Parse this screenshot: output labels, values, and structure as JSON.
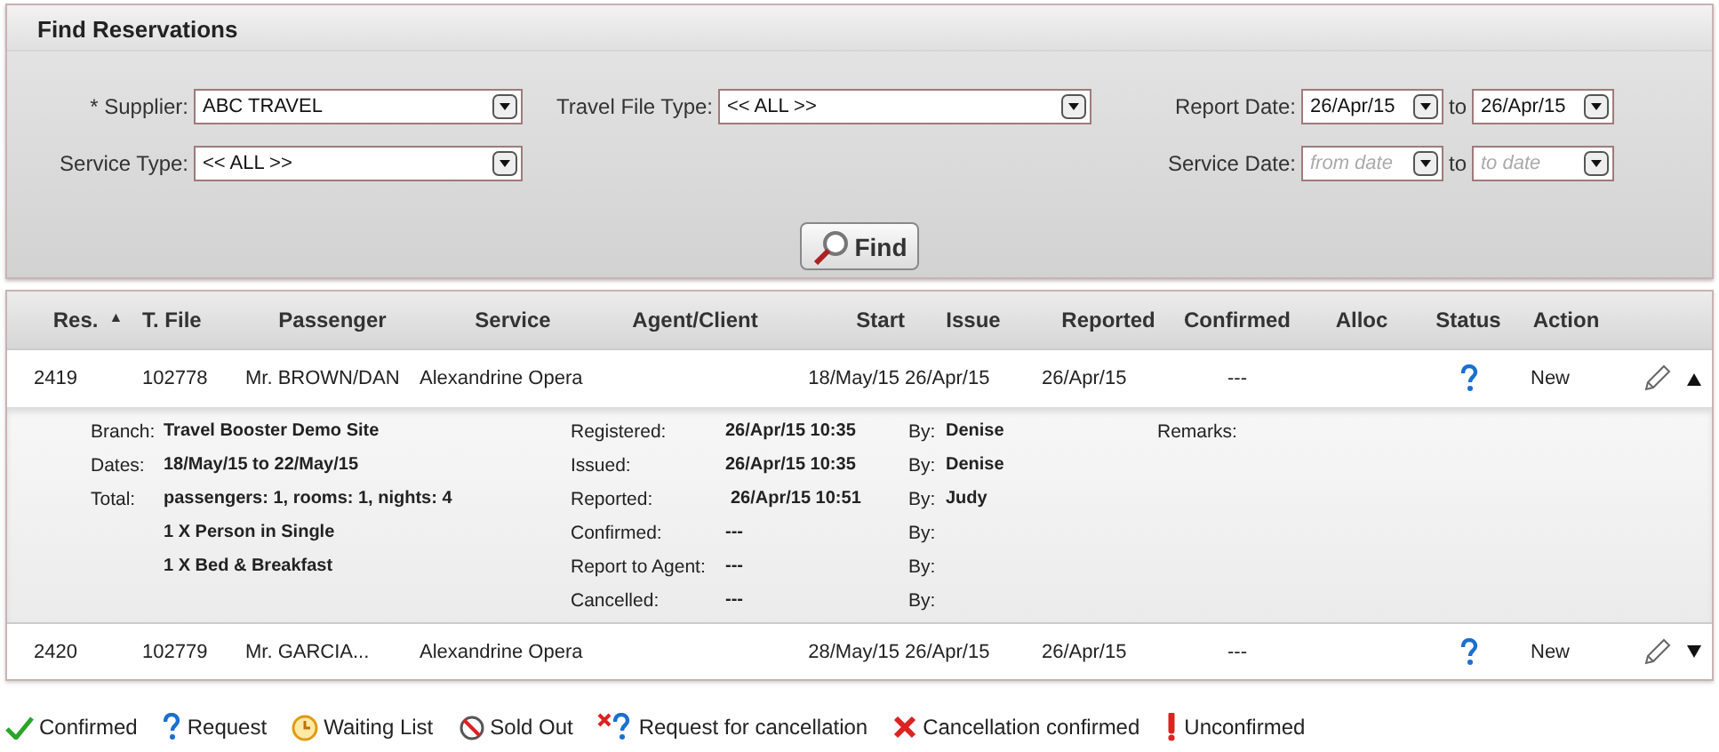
{
  "search_panel": {
    "title": "Find Reservations",
    "field_columns": [
      [
        {
          "kind": "select",
          "label": "* Supplier:",
          "value": "ABC TRAVEL"
        },
        {
          "kind": "select",
          "label": "Service Type:",
          "value": "<< ALL >>"
        }
      ],
      [
        {
          "kind": "select",
          "label": "Travel File Type:",
          "value": "<< ALL >>"
        }
      ],
      [
        {
          "kind": "range",
          "label": "Report Date:",
          "from": {
            "value": "26/Apr/15"
          },
          "separator": "to",
          "to": {
            "value": "26/Apr/15"
          }
        },
        {
          "kind": "range",
          "label": "Service Date:",
          "from": {
            "placeholder": "from date"
          },
          "separator": "to",
          "to": {
            "placeholder": "to date"
          }
        }
      ]
    ],
    "find_button": "Find"
  },
  "table": {
    "columns": [
      {
        "label": "Res.",
        "sort_indicator": "▲"
      },
      {
        "label": "T. File"
      },
      {
        "label": "Passenger"
      },
      {
        "label": "Service"
      },
      {
        "label": "Agent/Client"
      },
      {
        "label": "Start"
      },
      {
        "label": "Issue"
      },
      {
        "label": "Reported"
      },
      {
        "label": "Confirmed"
      },
      {
        "label": "Alloc"
      },
      {
        "label": "Status"
      },
      {
        "label": "Action"
      }
    ],
    "rows": [
      {
        "res": "2419",
        "t_file": "102778",
        "passenger": "Mr. BROWN/DAN",
        "service": "Alexandrine Opera",
        "start": "18/May/15",
        "issue": "26/Apr/15",
        "reported": "26/Apr/15",
        "confirmed": "---",
        "status": {
          "kind": "request"
        },
        "action": "New",
        "expanded": true,
        "details": {
          "info": [
            {
              "label": "Branch:",
              "value": "Travel Booster Demo Site"
            },
            {
              "label": "Dates:",
              "value": "18/May/15  to  22/May/15"
            },
            {
              "label": "Total:",
              "value": "passengers: 1, rooms: 1, nights: 4"
            },
            {
              "value": "1 X Person in Single"
            },
            {
              "value": "1 X Bed & Breakfast"
            }
          ],
          "events": [
            {
              "label": "Registered:",
              "value": "26/Apr/15 10:35",
              "by_label": "By:",
              "by": "Denise"
            },
            {
              "label": "Issued:",
              "value": "26/Apr/15 10:35",
              "by_label": "By:",
              "by": "Denise"
            },
            {
              "label": "Reported:",
              "value": "26/Apr/15 10:51",
              "by_label": "By:",
              "by": "Judy"
            },
            {
              "label": "Confirmed:",
              "value": "---",
              "by_label": "By:"
            },
            {
              "label": "Report to Agent:",
              "value": "---",
              "by_label": "By:"
            },
            {
              "label": "Cancelled:",
              "value": "---",
              "by_label": "By:"
            }
          ],
          "remarks_label": "Remarks:"
        }
      },
      {
        "res": "2420",
        "t_file": "102779",
        "passenger": "Mr. GARCIA...",
        "service": "Alexandrine Opera",
        "start": "28/May/15",
        "issue": "26/Apr/15",
        "reported": "26/Apr/15",
        "confirmed": "---",
        "status": {
          "kind": "request"
        },
        "action": "New",
        "expanded": false
      }
    ]
  },
  "legend": [
    {
      "kind": "confirmed",
      "label": "Confirmed"
    },
    {
      "kind": "request",
      "label": "Request"
    },
    {
      "kind": "waiting",
      "label": "Waiting List"
    },
    {
      "kind": "sold_out",
      "label": "Sold Out"
    },
    {
      "kind": "request_cancel",
      "label": "Request for cancellation"
    },
    {
      "kind": "cancel_confirmed",
      "label": "Cancellation confirmed"
    },
    {
      "kind": "unconfirmed",
      "label": "Unconfirmed"
    }
  ]
}
